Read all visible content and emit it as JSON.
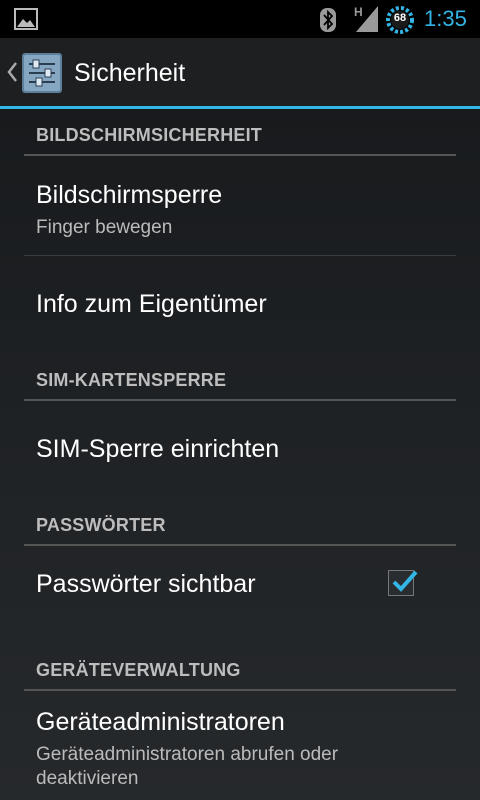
{
  "status_bar": {
    "time": "1:35",
    "battery_level": "68",
    "network_type": "H"
  },
  "action_bar": {
    "title": "Sicherheit"
  },
  "sections": {
    "screen_security": {
      "header": "BILDSCHIRMSICHERHEIT",
      "screen_lock": {
        "title": "Bildschirmsperre",
        "summary": "Finger bewegen"
      },
      "owner_info": {
        "title": "Info zum Eigentümer"
      }
    },
    "sim_lock": {
      "header": "SIM-KARTENSPERRE",
      "setup": {
        "title": "SIM-Sperre einrichten"
      }
    },
    "passwords": {
      "header": "PASSWÖRTER",
      "visible": {
        "title": "Passwörter sichtbar",
        "checked": true
      }
    },
    "device_admin": {
      "header": "GERÄTEVERWALTUNG",
      "admins": {
        "title": "Geräteadministratoren",
        "summary": "Geräteadministratoren abrufen oder deaktivieren"
      }
    }
  },
  "colors": {
    "accent": "#33b5e5"
  }
}
